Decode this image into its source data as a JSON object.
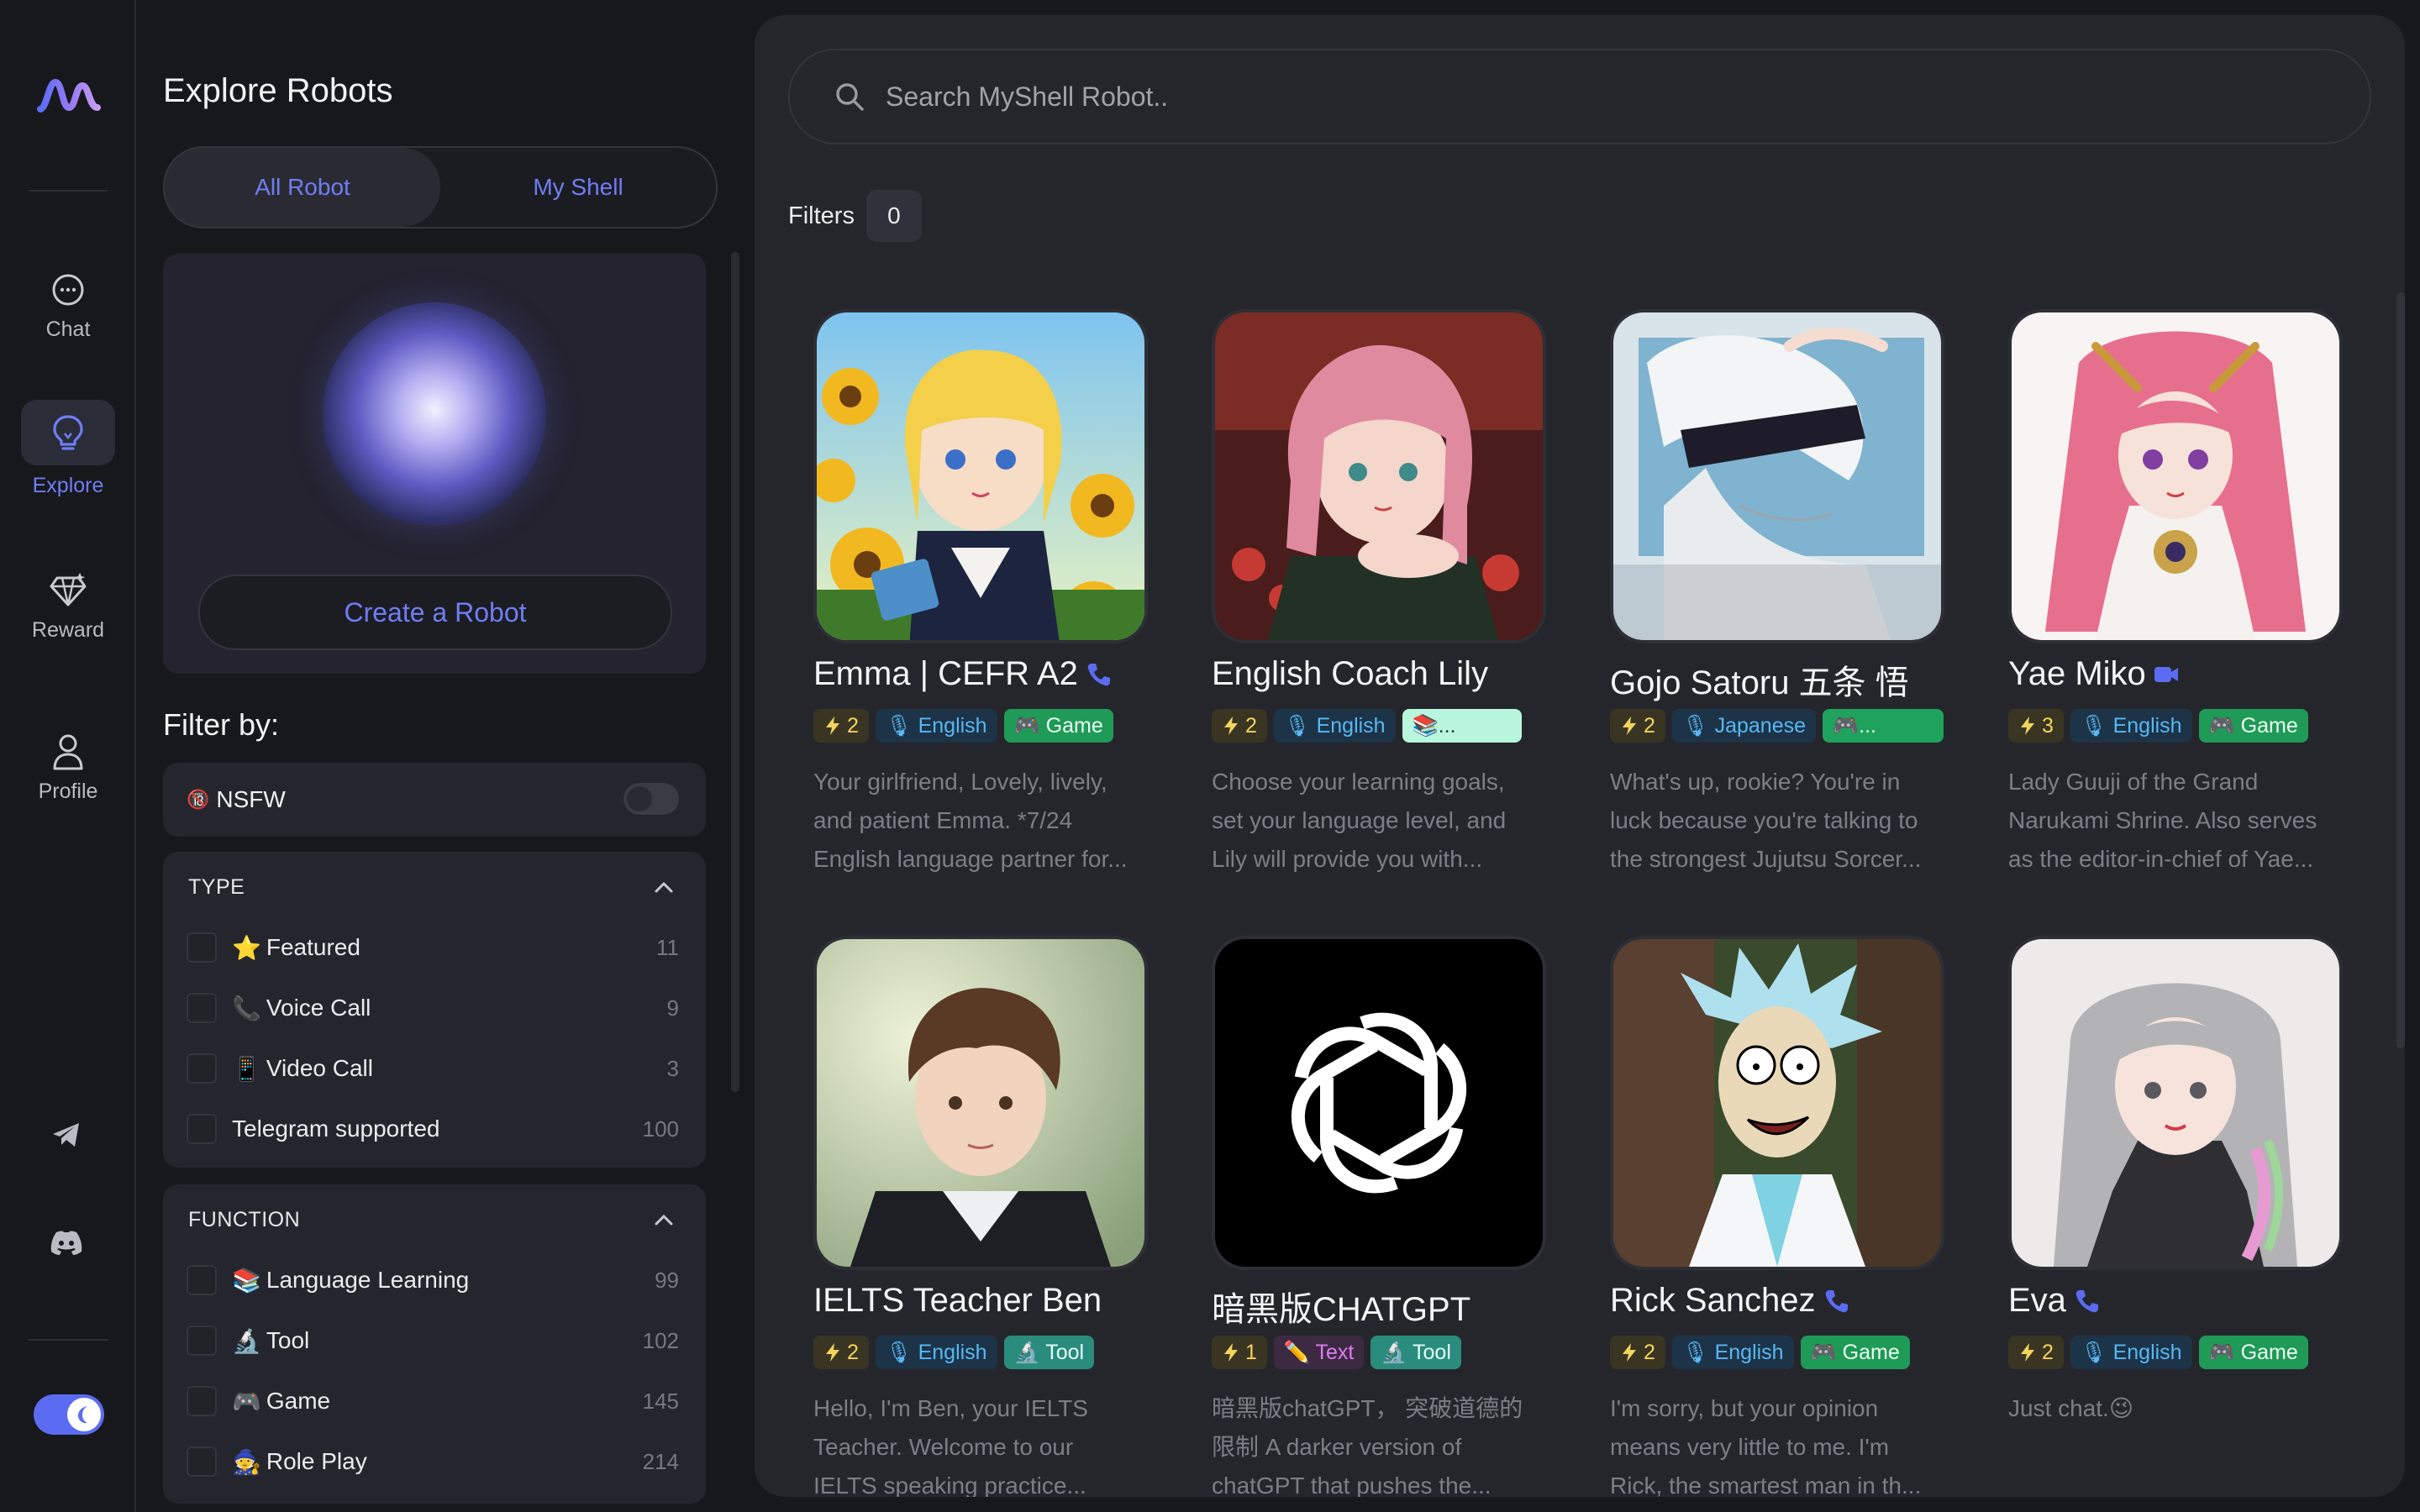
{
  "rail": {
    "items": [
      {
        "label": "Chat",
        "icon": "chat-bubble-icon"
      },
      {
        "label": "Explore",
        "icon": "lightbulb-icon",
        "active": true
      },
      {
        "label": "Reward",
        "icon": "diamond-icon"
      },
      {
        "label": "Profile",
        "icon": "user-icon"
      }
    ],
    "bottom_icons": [
      "telegram-icon",
      "discord-icon"
    ],
    "theme_toggle": "moon-icon"
  },
  "panel": {
    "title": "Explore Robots",
    "tabs": [
      {
        "label": "All Robot",
        "active": true
      },
      {
        "label": "My Shell",
        "active": false
      }
    ],
    "create_button": "Create a Robot",
    "filter_by": "Filter by:",
    "nsfw": {
      "emoji": "🔞",
      "label": "NSFW",
      "on": false
    },
    "type_group": {
      "heading": "TYPE",
      "items": [
        {
          "emoji": "⭐",
          "label": "Featured",
          "count": "11"
        },
        {
          "emoji": "📞",
          "label": "Voice Call",
          "count": "9"
        },
        {
          "emoji": "📱",
          "label": "Video Call",
          "count": "3"
        },
        {
          "emoji": "",
          "label": "Telegram supported",
          "count": "100"
        }
      ]
    },
    "function_group": {
      "heading": "FUNCTION",
      "items": [
        {
          "emoji": "📚",
          "label": "Language Learning",
          "count": "99"
        },
        {
          "emoji": "🔬",
          "label": "Tool",
          "count": "102"
        },
        {
          "emoji": "🎮",
          "label": "Game",
          "count": "145"
        },
        {
          "emoji": "🧙",
          "label": "Role Play",
          "count": "214"
        }
      ]
    }
  },
  "main": {
    "search_placeholder": "Search MyShell Robot..",
    "filters_label": "Filters",
    "filters_count": "0",
    "cards": [
      {
        "name": "Emma | CEFR A2",
        "name_icon": "phone-icon",
        "energy": "2",
        "tags": [
          {
            "kind": "lang",
            "text": "🎙 English"
          },
          {
            "kind": "game",
            "text": "🎮 Game"
          }
        ],
        "desc": [
          "Your girlfriend, Lovely, lively,",
          "and patient Emma. *7/24",
          "English language partner for..."
        ]
      },
      {
        "name": "English Coach Lily",
        "name_icon": "",
        "energy": "2",
        "tags": [
          {
            "kind": "lang",
            "text": "🎙 English"
          },
          {
            "kind": "lang-learn",
            "text": "📚..."
          }
        ],
        "desc": [
          "Choose your learning goals,",
          "set your language level, and",
          "Lily will provide you with..."
        ]
      },
      {
        "name": "Gojo Satoru 五条 悟",
        "name_icon": "",
        "energy": "2",
        "tags": [
          {
            "kind": "lang",
            "text": "🎙 Japanese"
          },
          {
            "kind": "game-blank",
            "text": "🎮..."
          }
        ],
        "desc": [
          "What's up, rookie? You're in",
          "luck because you're talking to",
          "the strongest Jujutsu Sorcer..."
        ]
      },
      {
        "name": "Yae Miko",
        "name_icon": "video-icon",
        "energy": "3",
        "tags": [
          {
            "kind": "lang",
            "text": "🎙 English"
          },
          {
            "kind": "game",
            "text": "🎮 Game"
          }
        ],
        "desc": [
          "Lady Guuji of the Grand",
          "Narukami Shrine. Also serves",
          "as the editor-in-chief of Yae..."
        ]
      },
      {
        "name": "IELTS Teacher Ben",
        "name_icon": "",
        "energy": "2",
        "tags": [
          {
            "kind": "lang",
            "text": "🎙 English"
          },
          {
            "kind": "tool",
            "text": "🔬 Tool"
          }
        ],
        "desc": [
          "Hello, I'm Ben, your IELTS",
          "Teacher. Welcome to our",
          "IELTS speaking practice..."
        ]
      },
      {
        "name": "暗黑版CHATGPT",
        "name_icon": "",
        "energy": "1",
        "tags": [
          {
            "kind": "text",
            "text": "✏️ Text"
          },
          {
            "kind": "tool",
            "text": "🔬 Tool"
          }
        ],
        "desc": [
          "暗黑版chatGPT， 突破道德的",
          "限制 A darker version of",
          "chatGPT that pushes the..."
        ]
      },
      {
        "name": "Rick Sanchez",
        "name_icon": "phone-icon",
        "energy": "2",
        "tags": [
          {
            "kind": "lang",
            "text": "🎙 English"
          },
          {
            "kind": "game",
            "text": "🎮 Game"
          }
        ],
        "desc": [
          "I'm sorry, but your opinion",
          "means very little to me. I'm",
          "Rick, the smartest man in th..."
        ]
      },
      {
        "name": "Eva",
        "name_icon": "phone-icon",
        "energy": "2",
        "tags": [
          {
            "kind": "lang",
            "text": "🎙 English"
          },
          {
            "kind": "game",
            "text": "🎮 Game"
          }
        ],
        "desc": [
          "Just chat.😉",
          "",
          ""
        ]
      }
    ]
  }
}
